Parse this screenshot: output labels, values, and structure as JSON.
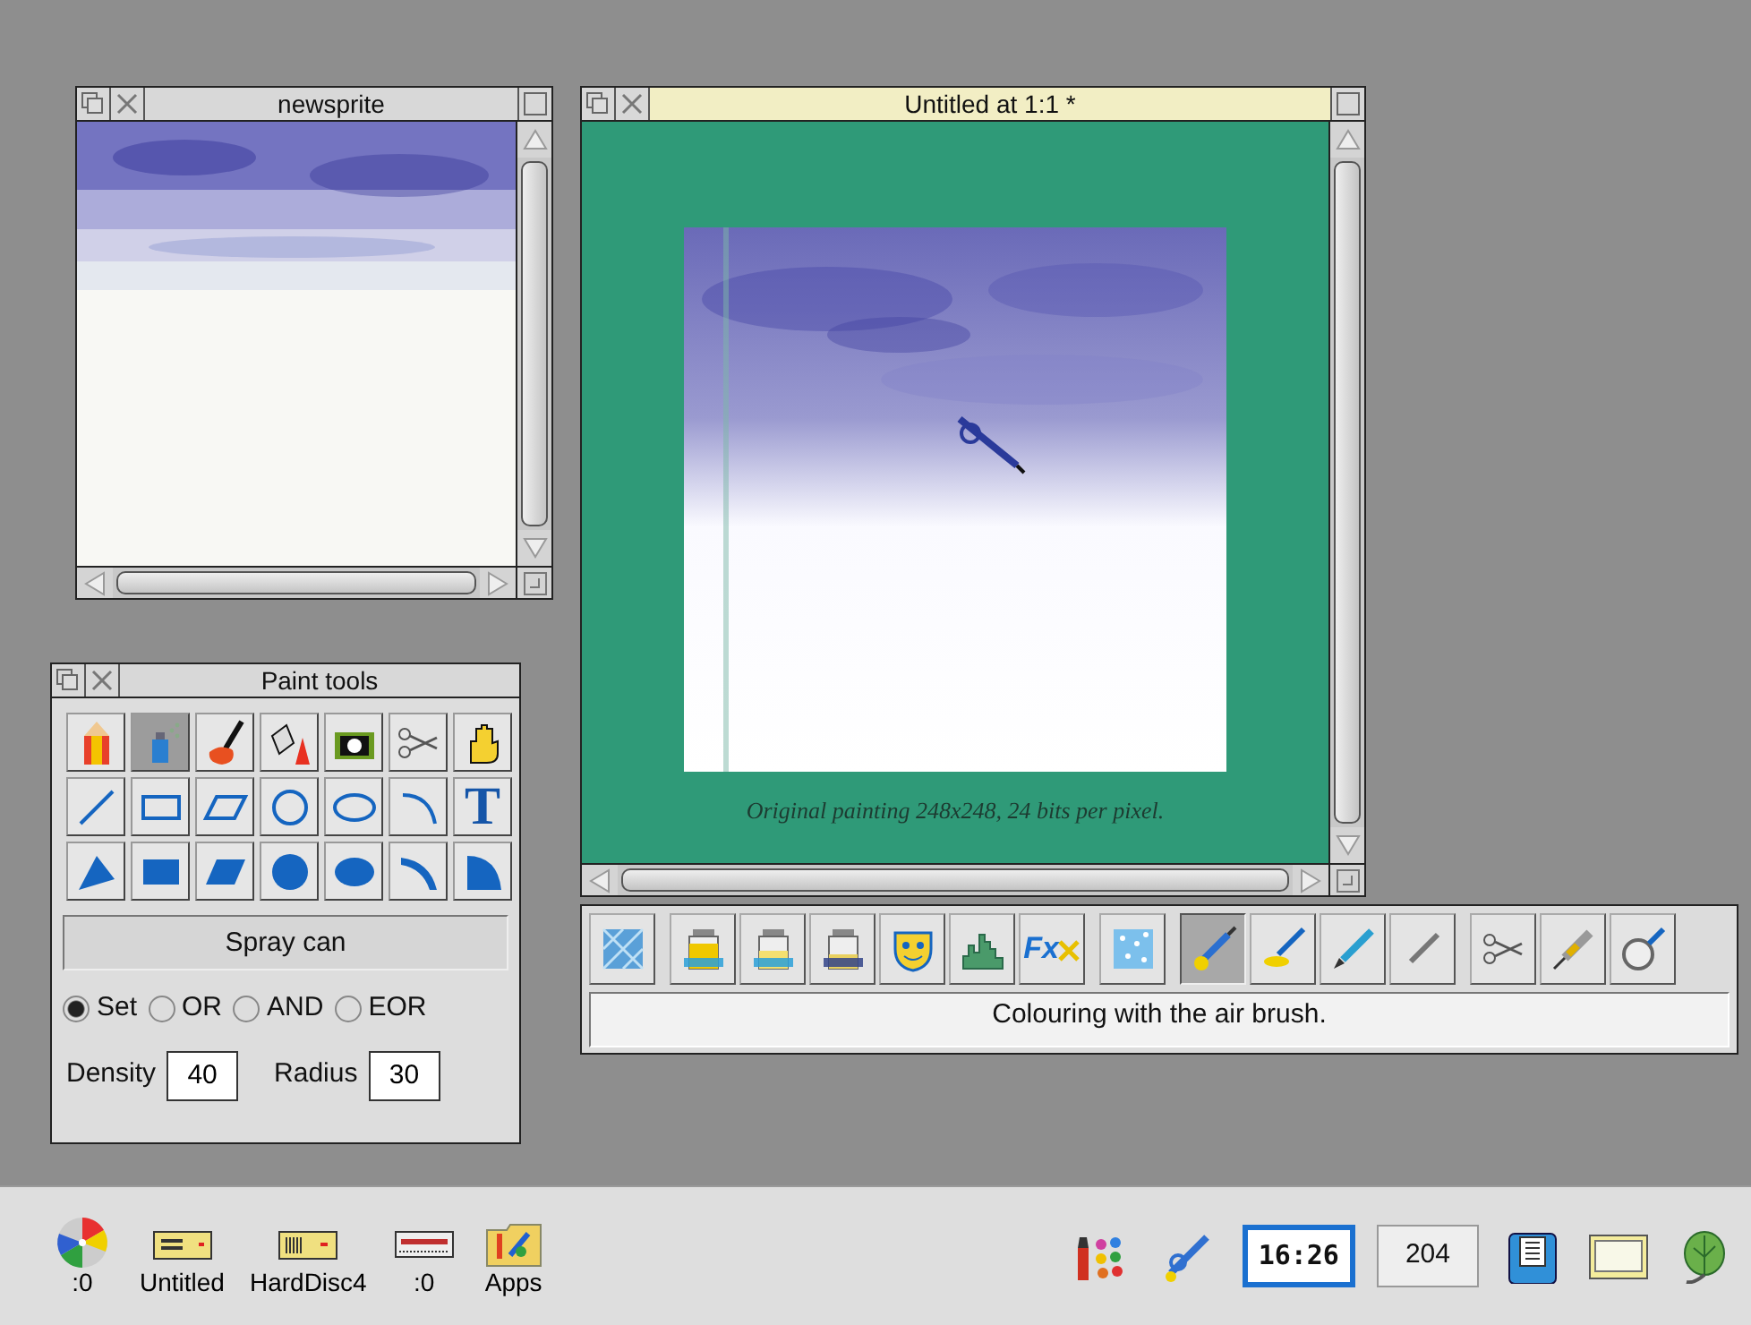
{
  "sprite_window": {
    "title": "newsprite",
    "focused": false
  },
  "painting_window": {
    "title": "Untitled at 1:1 *",
    "focused": true,
    "caption": "Original painting 248x248, 24 bits per pixel."
  },
  "paint_tools": {
    "title": "Paint tools",
    "focused": false,
    "tools": [
      {
        "kind": "pencil",
        "selected": false
      },
      {
        "kind": "spray",
        "selected": true
      },
      {
        "kind": "brush",
        "selected": false
      },
      {
        "kind": "fill",
        "selected": false
      },
      {
        "kind": "camera",
        "selected": false
      },
      {
        "kind": "scissors",
        "selected": false
      },
      {
        "kind": "hand",
        "selected": false
      },
      {
        "kind": "line",
        "selected": false
      },
      {
        "kind": "rectangle",
        "selected": false
      },
      {
        "kind": "parallelogram",
        "selected": false
      },
      {
        "kind": "circle",
        "selected": false
      },
      {
        "kind": "ellipse",
        "selected": false
      },
      {
        "kind": "arc",
        "selected": false
      },
      {
        "kind": "text",
        "label": "T",
        "selected": false
      },
      {
        "kind": "triangle",
        "selected": false
      },
      {
        "kind": "filled-rectangle",
        "selected": false
      },
      {
        "kind": "filled-parallelogram",
        "selected": false
      },
      {
        "kind": "filled-circle",
        "selected": false
      },
      {
        "kind": "filled-ellipse",
        "selected": false
      },
      {
        "kind": "segment",
        "selected": false
      },
      {
        "kind": "sector",
        "selected": false
      }
    ],
    "tool_name": "Spray can",
    "plot_modes": [
      {
        "label": "Set",
        "selected": true
      },
      {
        "label": "OR",
        "selected": false
      },
      {
        "label": "AND",
        "selected": false
      },
      {
        "label": "EOR",
        "selected": false
      }
    ],
    "fields": [
      {
        "label": "Density",
        "value": "40"
      },
      {
        "label": "Radius",
        "value": "30"
      }
    ]
  },
  "toolbar": {
    "buttons": [
      {
        "kind": "texture",
        "selected": false
      },
      {
        "kind": "jar-full",
        "selected": false,
        "group_start": true
      },
      {
        "kind": "jar-half",
        "selected": false
      },
      {
        "kind": "jar-low",
        "selected": false
      },
      {
        "kind": "mask",
        "selected": false
      },
      {
        "kind": "histogram",
        "selected": false
      },
      {
        "kind": "effects",
        "label": "Fx",
        "selected": false
      },
      {
        "kind": "noise",
        "selected": false,
        "group_start": true
      },
      {
        "kind": "airbrush",
        "selected": true,
        "group_start": true
      },
      {
        "kind": "brush",
        "selected": false
      },
      {
        "kind": "pencil",
        "selected": false
      },
      {
        "kind": "pen",
        "selected": false
      },
      {
        "kind": "scissors",
        "selected": false,
        "group_start": true
      },
      {
        "kind": "syringe",
        "selected": false
      },
      {
        "kind": "magnifier",
        "selected": false
      }
    ],
    "status": "Colouring with the air brush."
  },
  "icon_bar": {
    "left": [
      {
        "kind": "cd",
        "label": ":0"
      },
      {
        "kind": "floppy",
        "label": "Untitled"
      },
      {
        "kind": "harddisc",
        "label": "HardDisc4"
      },
      {
        "kind": "network",
        "label": ":0"
      },
      {
        "kind": "apps",
        "label": "Apps"
      }
    ],
    "right": [
      {
        "kind": "paint"
      },
      {
        "kind": "airbrush"
      },
      {
        "kind": "clock",
        "label": "16:26"
      },
      {
        "kind": "counter",
        "label": "204"
      },
      {
        "kind": "disc"
      },
      {
        "kind": "monitor"
      },
      {
        "kind": "leaf"
      }
    ]
  }
}
